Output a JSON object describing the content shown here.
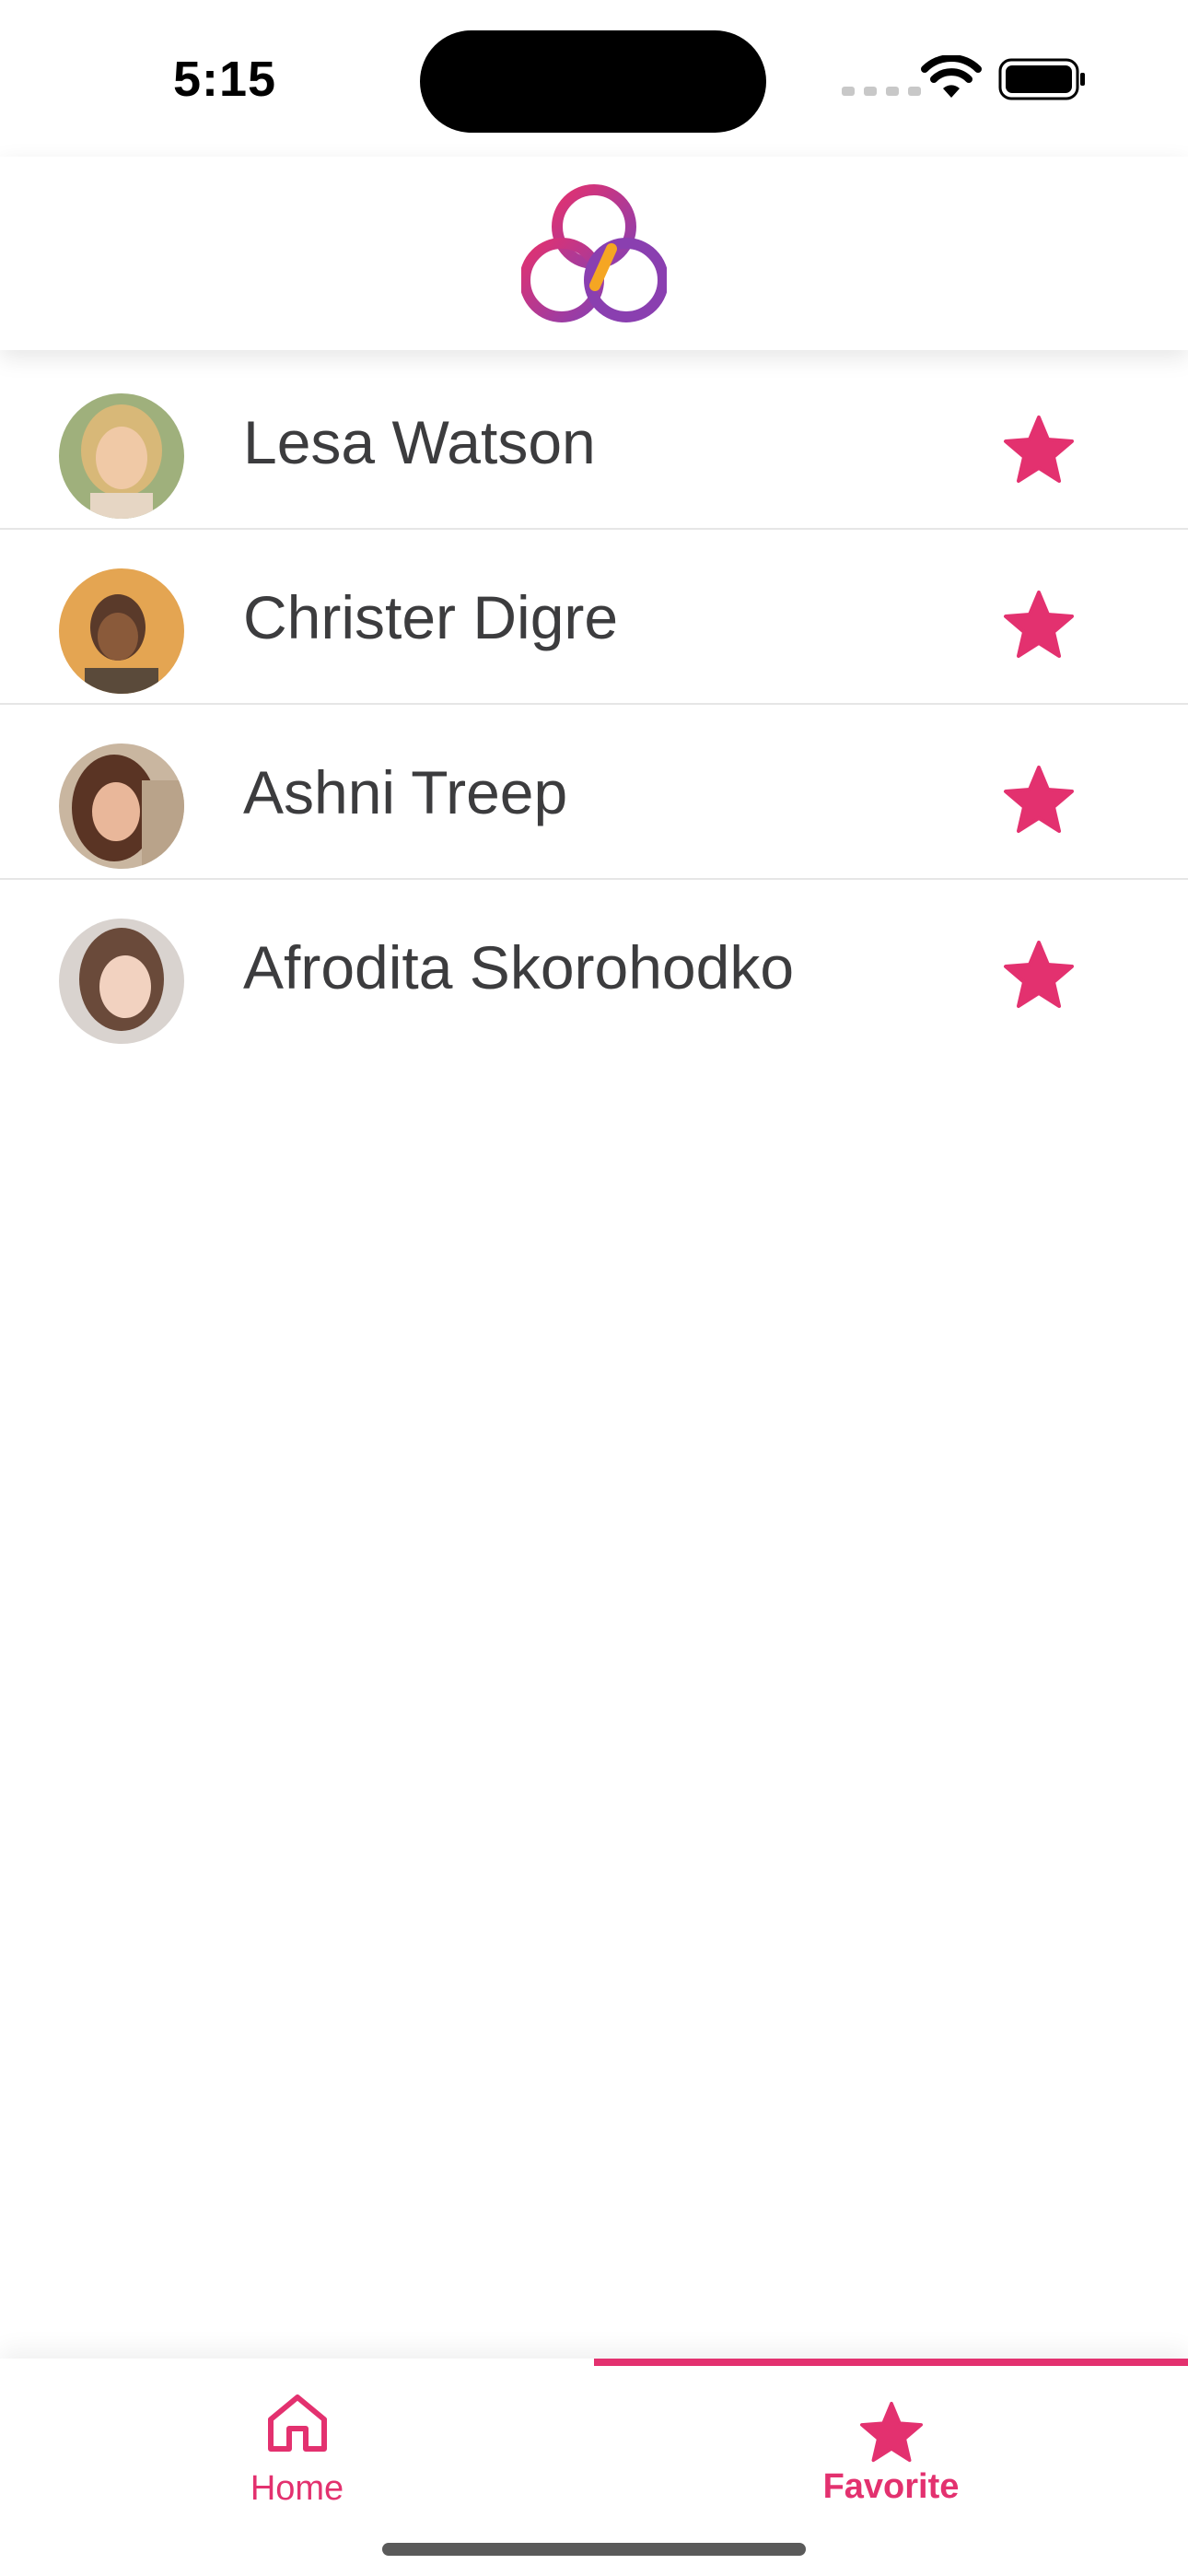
{
  "status_bar": {
    "time": "5:15"
  },
  "contacts": [
    {
      "name": "Lesa Watson",
      "avatar_color": "#a9b98a"
    },
    {
      "name": "Christer Digre",
      "avatar_color": "#d99a4a"
    },
    {
      "name": "Ashni Treep",
      "avatar_color": "#8a6a5a"
    },
    {
      "name": "Afrodita Skorohodko",
      "avatar_color": "#b6a7a0"
    }
  ],
  "tabs": [
    {
      "label": "Home",
      "icon": "home-icon",
      "selected": false
    },
    {
      "label": "Favorite",
      "icon": "star-icon",
      "selected": true
    }
  ],
  "colors": {
    "accent": "#e3316f",
    "logo_purple": "#8a3fb0",
    "logo_orange": "#f5a623"
  }
}
